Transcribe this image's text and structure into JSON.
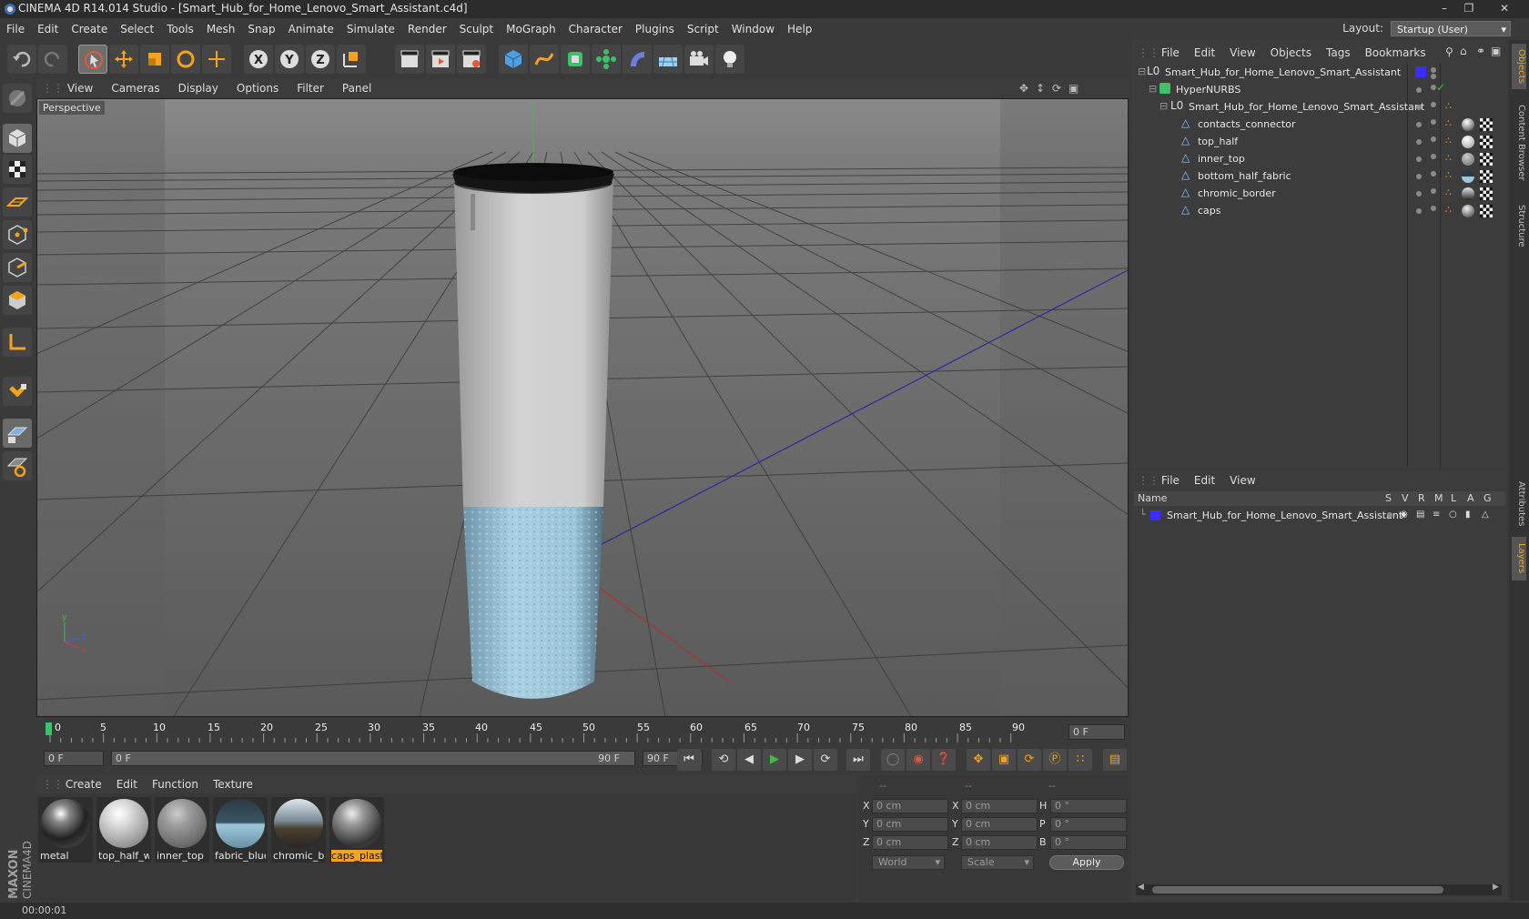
{
  "titlebar": {
    "text": "CINEMA 4D R14.014 Studio - [Smart_Hub_for_Home_Lenovo_Smart_Assistant.c4d]"
  },
  "menubar": [
    "File",
    "Edit",
    "Create",
    "Select",
    "Tools",
    "Mesh",
    "Snap",
    "Animate",
    "Simulate",
    "Render",
    "Sculpt",
    "MoGraph",
    "Character",
    "Plugins",
    "Script",
    "Window",
    "Help"
  ],
  "layout": {
    "label": "Layout:",
    "value": "Startup (User)"
  },
  "viewport": {
    "menu": [
      "View",
      "Cameras",
      "Display",
      "Options",
      "Filter",
      "Panel"
    ],
    "label": "Perspective"
  },
  "timeline": {
    "ticks": [
      "0",
      "5",
      "10",
      "15",
      "20",
      "25",
      "30",
      "35",
      "40",
      "45",
      "50",
      "55",
      "60",
      "65",
      "70",
      "75",
      "80",
      "85",
      "90"
    ],
    "current_frame": "0 F",
    "start_field": "0 F",
    "range_start": "0 F",
    "range_end": "90 F",
    "end_field": "90 F"
  },
  "materials": {
    "menu": [
      "Create",
      "Edit",
      "Function",
      "Texture"
    ],
    "items": [
      {
        "label": "metal"
      },
      {
        "label": "top_half_w"
      },
      {
        "label": "inner_top"
      },
      {
        "label": "fabric_blue"
      },
      {
        "label": "chromic_bc"
      },
      {
        "label": "caps_plasti"
      }
    ]
  },
  "coords": {
    "headers": [
      "--",
      "--",
      "--"
    ],
    "rows": [
      {
        "a": "X",
        "av": "0 cm",
        "b": "X",
        "bv": "0 cm",
        "c": "H",
        "cv": "0 °"
      },
      {
        "a": "Y",
        "av": "0 cm",
        "b": "Y",
        "bv": "0 cm",
        "c": "P",
        "cv": "0 °"
      },
      {
        "a": "Z",
        "av": "0 cm",
        "b": "Z",
        "bv": "0 cm",
        "c": "B",
        "cv": "0 °"
      }
    ],
    "mode1": "World",
    "mode2": "Scale",
    "apply": "Apply"
  },
  "status": {
    "time": "00:00:01"
  },
  "object_manager": {
    "menu": [
      "File",
      "Edit",
      "View",
      "Objects",
      "Tags",
      "Bookmarks"
    ],
    "rows": [
      {
        "name": "Smart_Hub_for_Home_Lenovo_Smart_Assistant"
      },
      {
        "name": "HyperNURBS"
      },
      {
        "name": "Smart_Hub_for_Home_Lenovo_Smart_Assistant"
      },
      {
        "name": "contacts_connector"
      },
      {
        "name": "top_half"
      },
      {
        "name": "inner_top"
      },
      {
        "name": "bottom_half_fabric"
      },
      {
        "name": "chromic_border"
      },
      {
        "name": "caps"
      }
    ]
  },
  "layer_manager": {
    "menu": [
      "File",
      "Edit",
      "View"
    ],
    "columns": [
      "Name",
      "S",
      "V",
      "R",
      "M",
      "L",
      "A",
      "G"
    ],
    "rows": [
      {
        "name": "Smart_Hub_for_Home_Lenovo_Smart_Assistant"
      }
    ]
  },
  "right_tabs": [
    "Objects",
    "Content Browser",
    "Structure",
    "Attributes",
    "Layers"
  ],
  "brand": {
    "line1": "MAXON",
    "line2": "CINEMA 4D"
  },
  "colors": {
    "accent": "#f5a31b",
    "layer": "#3b2cff"
  }
}
